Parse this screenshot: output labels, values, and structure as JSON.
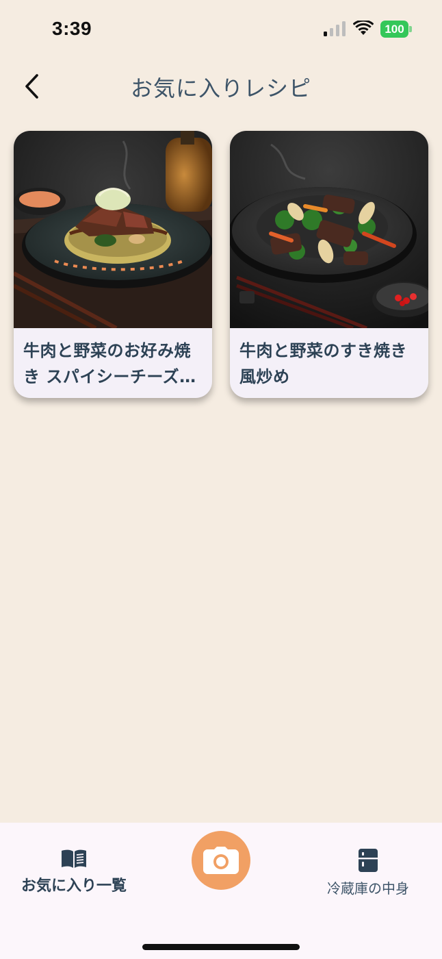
{
  "status_bar": {
    "time": "3:39",
    "battery": "100",
    "battery_color": "#34C759"
  },
  "header": {
    "title": "お気に入りレシピ",
    "back_icon": "chevron-left-icon"
  },
  "recipes": [
    {
      "title": "牛肉と野菜のお好み焼き スパイシーチーズソース添え",
      "image": "okonomiyaki-photo"
    },
    {
      "title": "牛肉と野菜のすき焼き風炒め",
      "image": "stir-fry-photo"
    }
  ],
  "tab_bar": {
    "favorites_label": "お気に入り一覧",
    "favorites_icon": "book-icon",
    "camera_icon": "camera-icon",
    "camera_color": "#F1A064",
    "fridge_label": "冷蔵庫の中身",
    "fridge_icon": "fridge-icon"
  },
  "colors": {
    "background": "#F5ECE1",
    "text": "#2D4255",
    "card": "#F4F0F8"
  }
}
